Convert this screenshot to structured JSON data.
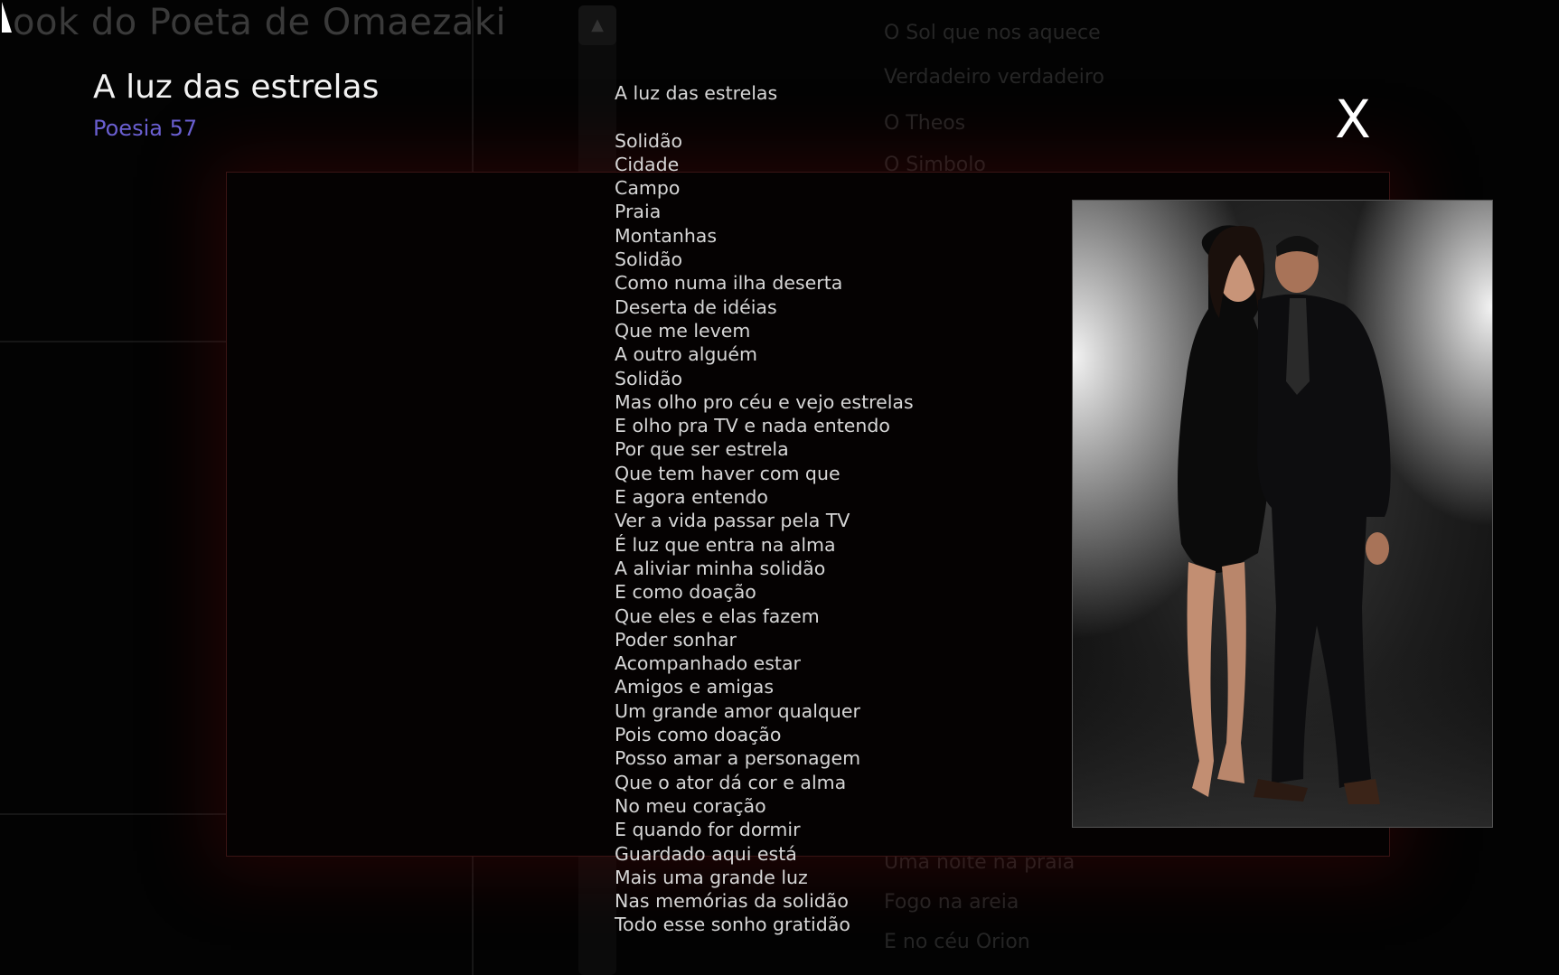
{
  "background": {
    "site_title": "ook do Poeta de Omaezaki",
    "links_top": [
      "O Sol que nos aquece",
      "Verdadeiro  verdadeiro",
      "O Theos",
      "O Simbolo"
    ],
    "links_bottom": [
      "Uma noite na praia",
      "Fogo na areia",
      "E no céu Orion"
    ]
  },
  "popup": {
    "title": "A luz das estrelas",
    "subtitle": "Poesia 57",
    "close_label": "X",
    "poem_heading": "A luz das estrelas",
    "poem_lines": [
      "Solidão",
      "Cidade",
      "Campo",
      "Praia",
      "Montanhas",
      "Solidão",
      "Como numa ilha deserta",
      "Deserta de idéias",
      "Que me levem",
      "A outro alguém",
      "Solidão",
      "Mas olho pro céu e vejo estrelas",
      "E olho pra TV e nada entendo",
      "Por que ser estrela",
      "Que tem haver com que",
      "E agora entendo",
      "Ver a vida passar pela TV",
      "É luz que entra na alma",
      "A aliviar minha solidão",
      "E como doação",
      "Que eles e elas fazem",
      "Poder sonhar",
      "Acompanhado estar",
      "Amigos e amigas",
      "Um grande amor qualquer",
      "Pois como doação",
      "Posso amar a personagem",
      "Que o ator dá cor e alma",
      "No meu coração",
      "E quando for dormir",
      "Guardado aqui está",
      "Mais uma grande luz",
      "Nas memórias da solidão",
      "Todo esse sonho gratidão"
    ]
  }
}
